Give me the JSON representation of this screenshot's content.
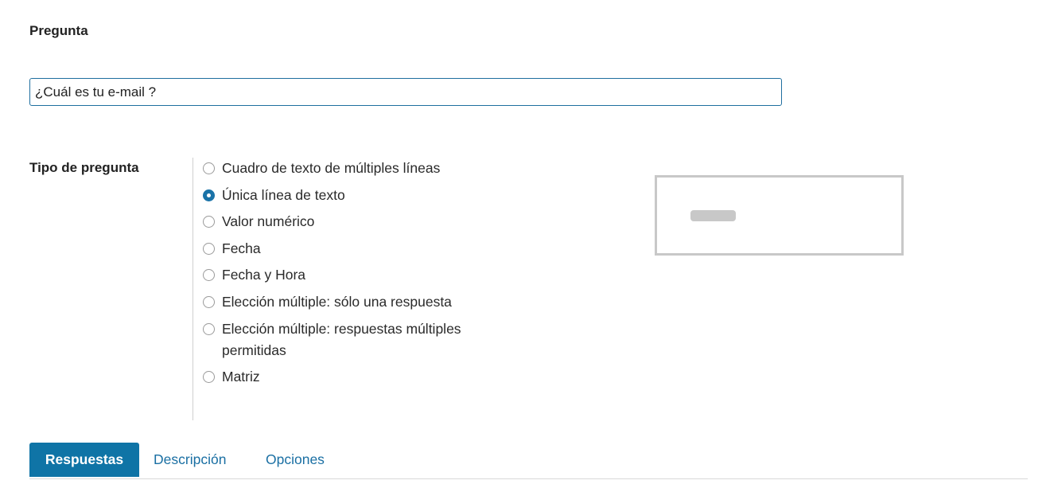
{
  "question": {
    "label": "Pregunta",
    "value": "¿Cuál es tu e-mail ?"
  },
  "question_type": {
    "label": "Tipo de pregunta",
    "selected": "Única línea de texto",
    "options": [
      {
        "label": "Cuadro de texto de múltiples líneas",
        "checked": false
      },
      {
        "label": "Única línea de texto",
        "checked": true
      },
      {
        "label": "Valor numérico",
        "checked": false
      },
      {
        "label": "Fecha",
        "checked": false
      },
      {
        "label": "Fecha y Hora",
        "checked": false
      },
      {
        "label": "Elección múltiple: sólo una respuesta",
        "checked": false
      },
      {
        "label": "Elección múltiple: respuestas múltiples permitidas",
        "checked": false
      },
      {
        "label": "Matriz",
        "checked": false
      }
    ]
  },
  "tabs": [
    {
      "label": "Respuestas",
      "active": true
    },
    {
      "label": "Descripción",
      "active": false
    },
    {
      "label": "Opciones",
      "active": false
    }
  ],
  "colors": {
    "accent": "#0f74a6",
    "link": "#1a6fa3",
    "input_border": "#1f6f9f",
    "preview_gray": "#c8c8c8"
  }
}
